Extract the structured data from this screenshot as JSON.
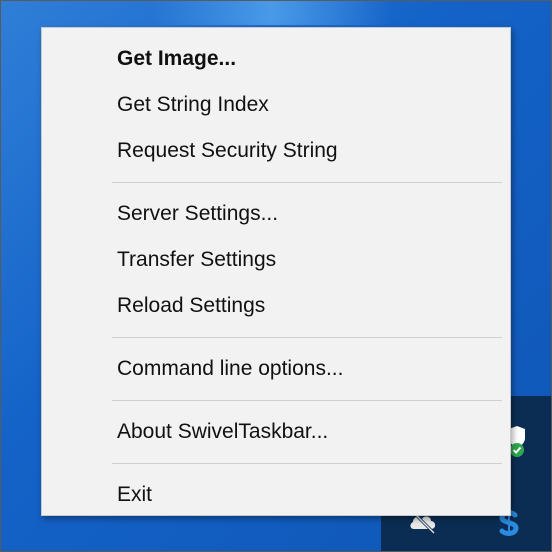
{
  "menu": {
    "items": [
      {
        "label": "Get Image...",
        "bold": true
      },
      {
        "label": "Get String Index"
      },
      {
        "label": "Request Security String"
      },
      {
        "label": "Server Settings..."
      },
      {
        "label": "Transfer Settings"
      },
      {
        "label": "Reload Settings"
      },
      {
        "label": "Command line options..."
      },
      {
        "label": "About SwivelTaskbar..."
      },
      {
        "label": "Exit"
      }
    ]
  },
  "tray": {
    "icons": [
      "defender-shield-icon",
      "cloud-offline-icon",
      "swivel-icon"
    ]
  },
  "colors": {
    "desktop": "#1463c8",
    "taskbar": "#0b2d54",
    "menu_bg": "#f2f2f2",
    "separator": "#cfcfcf",
    "text": "#111111",
    "defender_green": "#2fa84f",
    "swivel_blue": "#2a8be0"
  }
}
